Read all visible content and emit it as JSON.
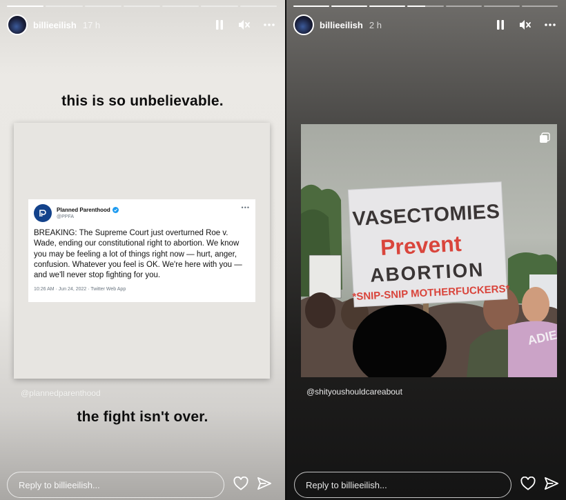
{
  "left_story": {
    "progress": [
      1,
      0,
      0,
      0,
      0,
      0,
      0
    ],
    "username": "billieeilish",
    "time": "17 h",
    "caption_top": "this is so unbelievable.",
    "caption_bottom": "the fight isn't over.",
    "mention": "@plannedparenthood",
    "reply_placeholder": "Reply to billieeilish...",
    "tweet": {
      "name": "Planned Parenthood",
      "handle": "@PPFA",
      "text": "BREAKING: The Supreme Court just overturned Roe v. Wade, ending our constitutional right to abortion. We know you may be feeling a lot of things right now — hurt, anger, confusion. Whatever you feel is OK. We're here with you — and we'll never stop fighting for you.",
      "meta": "10:26 AM · Jun 24, 2022 · Twitter Web App"
    }
  },
  "right_story": {
    "progress": [
      1,
      1,
      1,
      0.5,
      0,
      0,
      0
    ],
    "username": "billieeilish",
    "time": "2 h",
    "mention": "@shityoushouldcareabout",
    "reply_placeholder": "Reply to billieeilish...",
    "sign": {
      "line1": "VASECTOMIES",
      "line2": "Prevent",
      "line3": "ABORTION",
      "line4": "*SNIP-SNIP MOTHERFUCKERS*"
    },
    "shirt_text": "ADIES"
  },
  "icons": [
    "pause-icon",
    "mute-icon",
    "more-icon",
    "heart-icon",
    "send-icon",
    "carousel-icon",
    "verified-icon"
  ],
  "colors": {
    "sign_red": "#d9453c",
    "planned_parenthood_blue": "#13428b",
    "twitter_blue": "#1d9bf0"
  }
}
